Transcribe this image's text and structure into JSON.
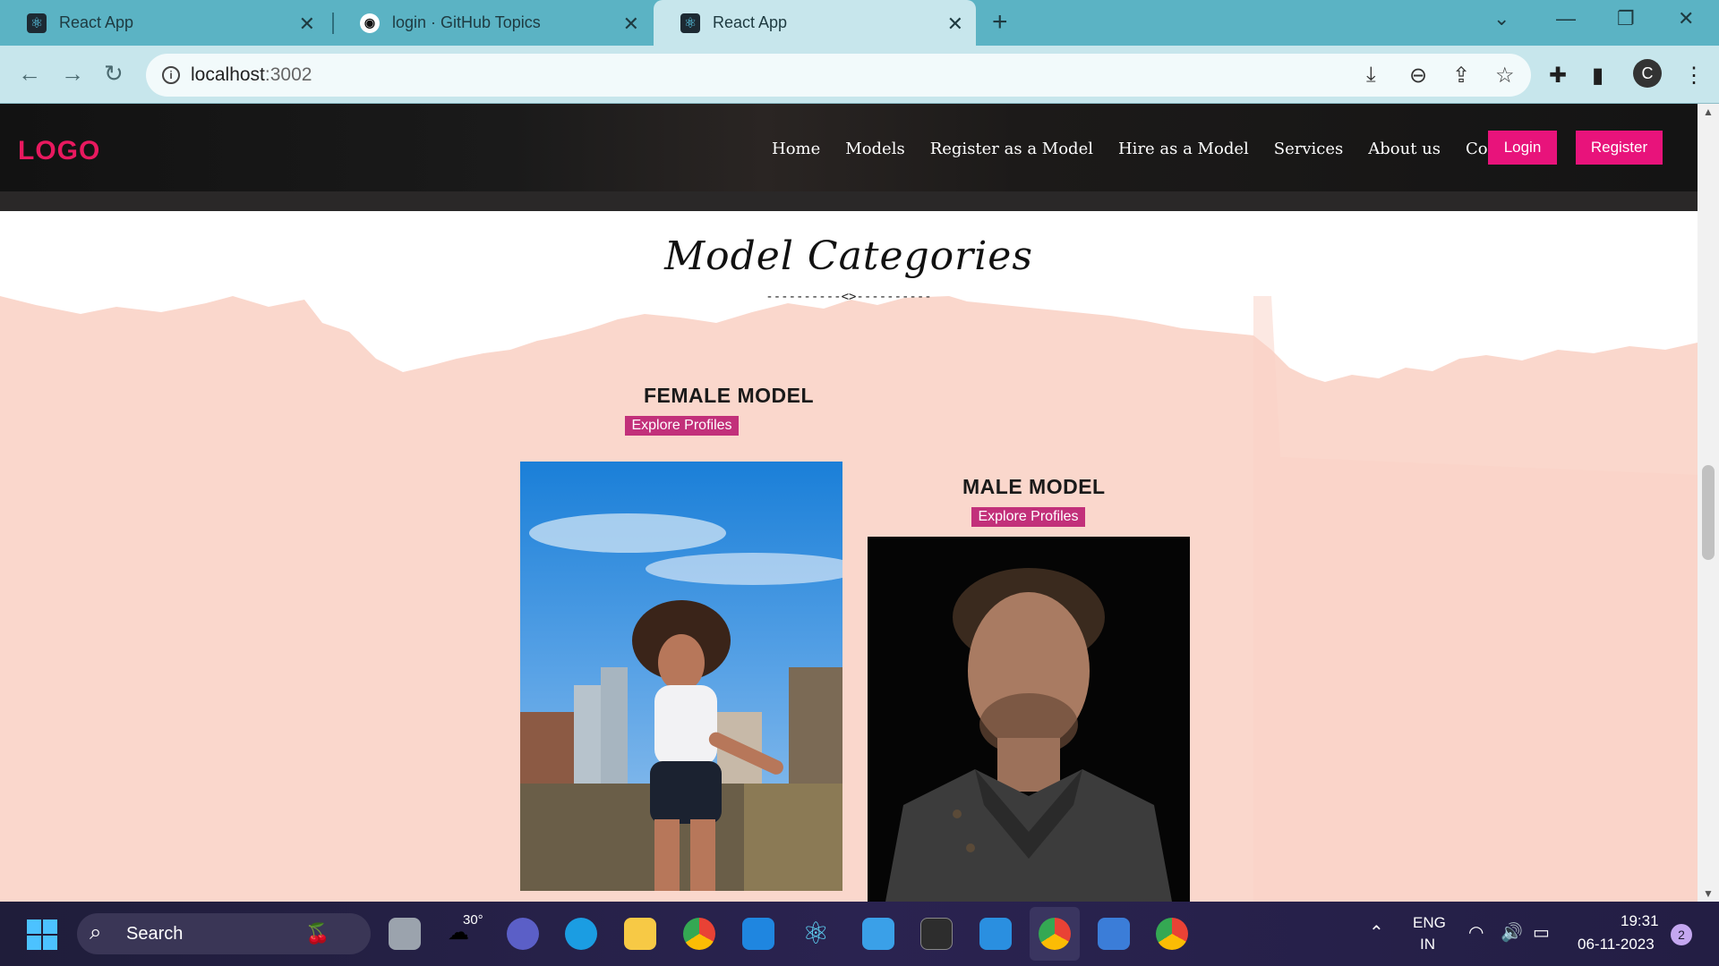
{
  "browser": {
    "tabs": [
      {
        "title": "React App",
        "icon": "react-icon"
      },
      {
        "title": "login · GitHub Topics",
        "icon": "github-icon"
      },
      {
        "title": "React App",
        "icon": "react-icon",
        "active": true
      }
    ],
    "url_host": "localhost",
    "url_port": ":3002"
  },
  "header": {
    "logo": "LOGO",
    "nav": [
      "Home",
      "Models",
      "Register as a Model",
      "Hire as a Model",
      "Services",
      "About us",
      "Contact us"
    ],
    "login_label": "Login",
    "register_label": "Register",
    "accent": "#e8137b"
  },
  "section": {
    "title": "Model Categories",
    "divider": "----------<>----------"
  },
  "categories": [
    {
      "title": "FEMALE MODEL",
      "button": "Explore Profiles"
    },
    {
      "title": "MALE MODEL",
      "button": "Explore Profiles"
    }
  ],
  "taskbar": {
    "search_label": "Search",
    "weather": "30°",
    "lang1": "ENG",
    "lang2": "IN",
    "time": "19:31",
    "date": "06-11-2023",
    "notifications": "2",
    "profile_initial": "C"
  }
}
